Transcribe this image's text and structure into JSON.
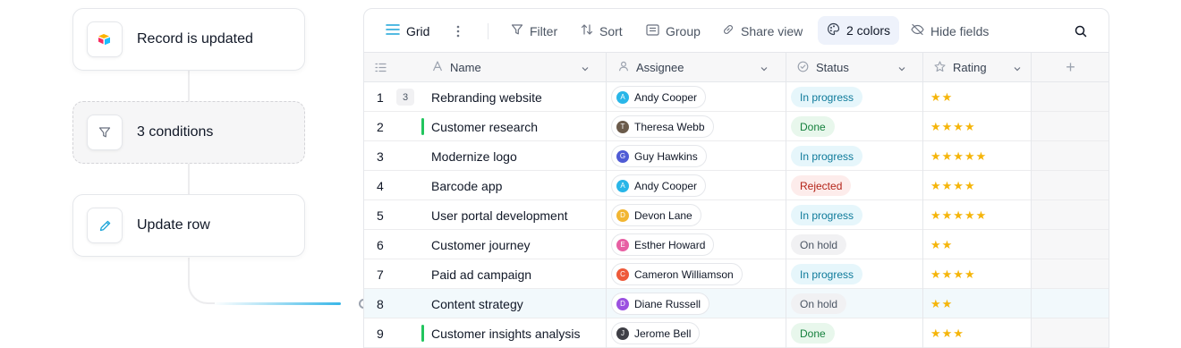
{
  "workflow": {
    "steps": [
      {
        "label": "Record is updated",
        "icon": "app-logo-icon"
      },
      {
        "label": "3 conditions",
        "icon": "filter-icon"
      },
      {
        "label": "Update row",
        "icon": "pencil-icon"
      }
    ]
  },
  "toolbar": {
    "view_label": "Grid",
    "filter_label": "Filter",
    "sort_label": "Sort",
    "group_label": "Group",
    "share_label": "Share view",
    "colors_label": "2 colors",
    "hide_label": "Hide fields"
  },
  "columns": {
    "name": "Name",
    "assignee": "Assignee",
    "status": "Status",
    "rating": "Rating",
    "add": "+"
  },
  "status_styles": {
    "In progress": {
      "bg": "#e6f6fb",
      "fg": "#0e7a9a"
    },
    "Done": {
      "bg": "#e8f7ec",
      "fg": "#15803d"
    },
    "Rejected": {
      "bg": "#fdeceb",
      "fg": "#b42318"
    },
    "On hold": {
      "bg": "#f1f1f3",
      "fg": "#4b5563"
    }
  },
  "rows": [
    {
      "num": "1",
      "count": "3",
      "flag": false,
      "name": "Rebranding website",
      "assignee": "Andy Cooper",
      "initial": "A",
      "avatar_color": "#29b6e8",
      "status": "In progress",
      "stars": "★★",
      "highlight": false
    },
    {
      "num": "2",
      "count": "",
      "flag": true,
      "name": "Customer research",
      "assignee": "Theresa Webb",
      "initial": "T",
      "avatar_color": "#6b5b4b",
      "status": "Done",
      "stars": "★★★★",
      "highlight": false
    },
    {
      "num": "3",
      "count": "",
      "flag": false,
      "name": "Modernize logo",
      "assignee": "Guy Hawkins",
      "initial": "G",
      "avatar_color": "#4f5bd5",
      "status": "In progress",
      "stars": "★★★★★",
      "highlight": false
    },
    {
      "num": "4",
      "count": "",
      "flag": false,
      "name": "Barcode app",
      "assignee": "Andy Cooper",
      "initial": "A",
      "avatar_color": "#29b6e8",
      "status": "Rejected",
      "stars": "★★★★",
      "highlight": false
    },
    {
      "num": "5",
      "count": "",
      "flag": false,
      "name": "User portal development",
      "assignee": "Devon Lane",
      "initial": "D",
      "avatar_color": "#f2b632",
      "status": "In progress",
      "stars": "★★★★★",
      "highlight": false
    },
    {
      "num": "6",
      "count": "",
      "flag": false,
      "name": "Customer journey",
      "assignee": "Esther Howard",
      "initial": "E",
      "avatar_color": "#e75fa3",
      "status": "On hold",
      "stars": "★★",
      "highlight": false
    },
    {
      "num": "7",
      "count": "",
      "flag": false,
      "name": "Paid ad campaign",
      "assignee": "Cameron Williamson",
      "initial": "C",
      "avatar_color": "#ee5a3a",
      "status": "In progress",
      "stars": "★★★★",
      "highlight": false
    },
    {
      "num": "8",
      "count": "",
      "flag": false,
      "name": "Content strategy",
      "assignee": "Diane Russell",
      "initial": "D",
      "avatar_color": "#9b51e0",
      "status": "On hold",
      "stars": "★★",
      "highlight": true
    },
    {
      "num": "9",
      "count": "",
      "flag": true,
      "name": "Customer insights analysis",
      "assignee": "Jerome Bell",
      "initial": "J",
      "avatar_color": "#3f3f46",
      "status": "Done",
      "stars": "★★★",
      "highlight": false
    }
  ]
}
